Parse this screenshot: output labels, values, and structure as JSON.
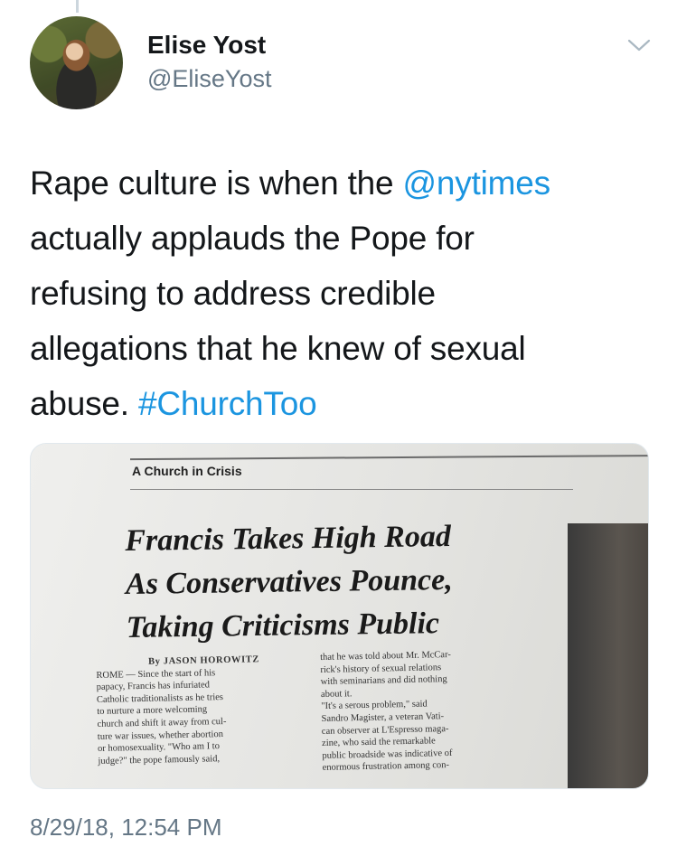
{
  "tweet": {
    "author": {
      "name": "Elise Yost",
      "handle": "@EliseYost"
    },
    "text": {
      "line1_pre": "Rape culture is when the ",
      "mention": "@nytimes",
      "line2": "actually applauds the Pope for",
      "line3": "refusing to address credible",
      "line4": "allegations that he knew of sexual",
      "line5_pre": "abuse. ",
      "hashtag": "#ChurchToo"
    },
    "timestamp": "8/29/18, 12:54 PM"
  },
  "media": {
    "kicker": "A Church in Crisis",
    "headline": [
      "Francis Takes High Road",
      "As Conservatives Pounce,",
      "Taking Criticisms Public"
    ],
    "col1": [
      "By JASON HOROWITZ",
      "ROME — Since the start of his",
      "papacy, Francis has infuriated",
      "Catholic traditionalists as he tries",
      "to nurture a more welcoming",
      "church and shift it away from cul-",
      "ture war issues, whether abortion",
      "or homosexuality. \"Who am I to",
      "judge?\" the pope famously said,"
    ],
    "col2": [
      "that he was told about Mr. McCar-",
      "rick's history of sexual relations",
      "with seminarians and did nothing",
      "about it.",
      "\"It's a serous problem,\" said",
      "Sandro Magister, a veteran Vati-",
      "can observer at L'Espresso maga-",
      "zine, who said the remarkable",
      "public broadside was indicative of",
      "enormous frustration among con-"
    ]
  },
  "colors": {
    "link": "#1b95e0",
    "secondary": "#657786",
    "text": "#14171a"
  }
}
